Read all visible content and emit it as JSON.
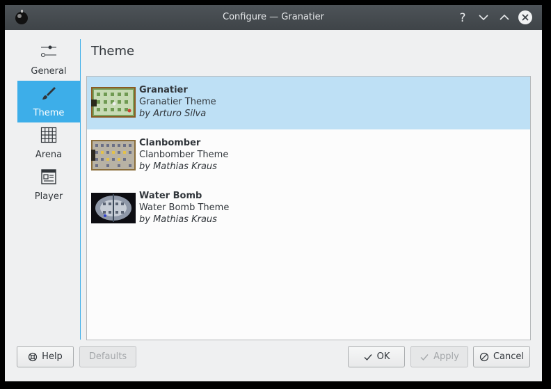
{
  "window": {
    "title": "Configure — Granatier"
  },
  "titlebar_buttons": [
    {
      "name": "help-icon",
      "label": "?"
    },
    {
      "name": "minimize-icon",
      "label": "minimize"
    },
    {
      "name": "maximize-icon",
      "label": "maximize"
    },
    {
      "name": "close-icon",
      "label": "close"
    }
  ],
  "sidebar": {
    "items": [
      {
        "label": "General",
        "icon": "sliders-icon",
        "active": false
      },
      {
        "label": "Theme",
        "icon": "brush-icon",
        "active": true
      },
      {
        "label": "Arena",
        "icon": "grid-icon",
        "active": false
      },
      {
        "label": "Player",
        "icon": "player-icon",
        "active": false
      }
    ]
  },
  "page": {
    "title": "Theme"
  },
  "themes": [
    {
      "name": "Granatier",
      "description": "Granatier Theme",
      "author": "by Arturo Silva",
      "selected": true
    },
    {
      "name": "Clanbomber",
      "description": "Clanbomber Theme",
      "author": "by Mathias Kraus",
      "selected": false
    },
    {
      "name": "Water Bomb",
      "description": "Water Bomb Theme",
      "author": "by Mathias Kraus",
      "selected": false
    }
  ],
  "buttons": {
    "help": "Help",
    "defaults": "Defaults",
    "ok": "OK",
    "apply": "Apply",
    "cancel": "Cancel"
  },
  "colors": {
    "accent": "#3daee9",
    "selection": "#bee0f5",
    "titlebar": "#474c50"
  }
}
